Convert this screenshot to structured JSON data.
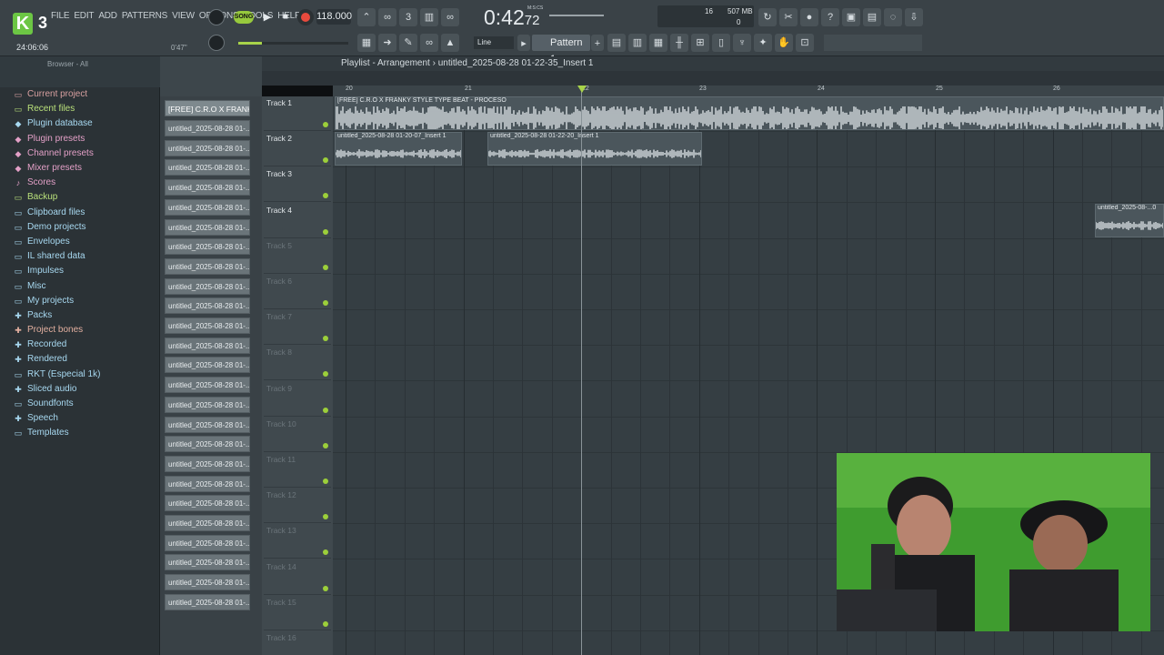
{
  "toolbar": {
    "logo_letter": "K",
    "logo_num": "3",
    "menu": [
      "FILE",
      "EDIT",
      "ADD",
      "PATTERNS",
      "VIEW",
      "OPTIONS",
      "TOOLS",
      "HELP"
    ],
    "song_label": "SONG",
    "tempo": "118.000",
    "clock_main": "0:42",
    "clock_small": "72",
    "clock_unit": "M:S:CS",
    "cpu": "16",
    "memory": "507 MB",
    "zero": "0",
    "time_small": "24:06:06",
    "hint_time": "0'47\"",
    "snap": "Line",
    "pattern": "Pattern 1",
    "plus": "+"
  },
  "browser": {
    "title": "Browser - All",
    "items": [
      {
        "label": "Current project",
        "icon": "folder-icon",
        "color": "#d8a0a0"
      },
      {
        "label": "Recent files",
        "icon": "folder-icon",
        "color": "#b9e07a"
      },
      {
        "label": "Plugin database",
        "icon": "plug-icon",
        "color": "#a7d8f0"
      },
      {
        "label": "Plugin presets",
        "icon": "plug-icon",
        "color": "#e3a0c7"
      },
      {
        "label": "Channel presets",
        "icon": "plug-icon",
        "color": "#e3a0c7"
      },
      {
        "label": "Mixer presets",
        "icon": "plug-icon",
        "color": "#e3a0c7"
      },
      {
        "label": "Scores",
        "icon": "note-icon",
        "color": "#e3a0c7"
      },
      {
        "label": "Backup",
        "icon": "folder-icon",
        "color": "#b9e07a"
      },
      {
        "label": "Clipboard files",
        "icon": "folder-icon",
        "color": "#a7d8f0"
      },
      {
        "label": "Demo projects",
        "icon": "folder-icon",
        "color": "#a7d8f0"
      },
      {
        "label": "Envelopes",
        "icon": "folder-icon",
        "color": "#a7d8f0"
      },
      {
        "label": "IL shared data",
        "icon": "folder-icon",
        "color": "#a7d8f0"
      },
      {
        "label": "Impulses",
        "icon": "folder-icon",
        "color": "#a7d8f0"
      },
      {
        "label": "Misc",
        "icon": "folder-icon",
        "color": "#a7d8f0"
      },
      {
        "label": "My projects",
        "icon": "folder-icon",
        "color": "#a7d8f0"
      },
      {
        "label": "Packs",
        "icon": "pack-icon",
        "color": "#a7d8f0"
      },
      {
        "label": "Project bones",
        "icon": "bones-icon",
        "color": "#e3b0a0"
      },
      {
        "label": "Recorded",
        "icon": "record-icon",
        "color": "#a7d8f0"
      },
      {
        "label": "Rendered",
        "icon": "render-icon",
        "color": "#a7d8f0"
      },
      {
        "label": "RKT (Especial 1k)",
        "icon": "folder-icon",
        "color": "#a7d8f0"
      },
      {
        "label": "Sliced audio",
        "icon": "slice-icon",
        "color": "#a7d8f0"
      },
      {
        "label": "Soundfonts",
        "icon": "folder-icon",
        "color": "#a7d8f0"
      },
      {
        "label": "Speech",
        "icon": "speech-icon",
        "color": "#a7d8f0"
      },
      {
        "label": "Templates",
        "icon": "folder-icon",
        "color": "#a7d8f0"
      }
    ]
  },
  "channels": {
    "first": "[FREE] C.R.O X FRANK...",
    "items": [
      "untitled_2025-08-28 01-...",
      "untitled_2025-08-28 01-...",
      "untitled_2025-08-28 01-...",
      "untitled_2025-08-28 01-...",
      "untitled_2025-08-28 01-...",
      "untitled_2025-08-28 01-...",
      "untitled_2025-08-28 01-...",
      "untitled_2025-08-28 01-...",
      "untitled_2025-08-28 01-...",
      "untitled_2025-08-28 01-...",
      "untitled_2025-08-28 01-...",
      "untitled_2025-08-28 01-...",
      "untitled_2025-08-28 01-...",
      "untitled_2025-08-28 01-...",
      "untitled_2025-08-28 01-...",
      "untitled_2025-08-28 01-...",
      "untitled_2025-08-28 01-...",
      "untitled_2025-08-28 01-...",
      "untitled_2025-08-28 01-...",
      "untitled_2025-08-28 01-...",
      "untitled_2025-08-28 01-...",
      "untitled_2025-08-28 01-...",
      "untitled_2025-08-28 01-...",
      "untitled_2025-08-28 01-...",
      "untitled_2025-08-28 01-..."
    ]
  },
  "playlist": {
    "title": "Playlist - Arrangement",
    "sep": "›",
    "project": "untitled_2025-08-28 01-22-35_Insert 1",
    "ruler": [
      "20",
      "21",
      "22",
      "23",
      "24",
      "25",
      "26"
    ],
    "tracks": [
      "Track 1",
      "Track 2",
      "Track 3",
      "Track 4",
      "Track 5",
      "Track 6",
      "Track 7",
      "Track 8",
      "Track 9",
      "Track 10",
      "Track 11",
      "Track 12",
      "Track 13",
      "Track 14",
      "Track 15",
      "Track 16"
    ],
    "clips": [
      {
        "label": "[FREE] C.R.O X FRANKY STYLE TYPE BEAT - PROCESO"
      },
      {
        "label": "untitled_2025-08-28 01-20-07_Insert 1"
      },
      {
        "label": "untitled_2025-08-28 01-22-20_Insert 1"
      },
      {
        "label": "untitled_2025-08-...0"
      }
    ]
  },
  "colors": {
    "accent": "#a8d34a",
    "panel": "#2b3236",
    "record": "#e84a3d"
  }
}
